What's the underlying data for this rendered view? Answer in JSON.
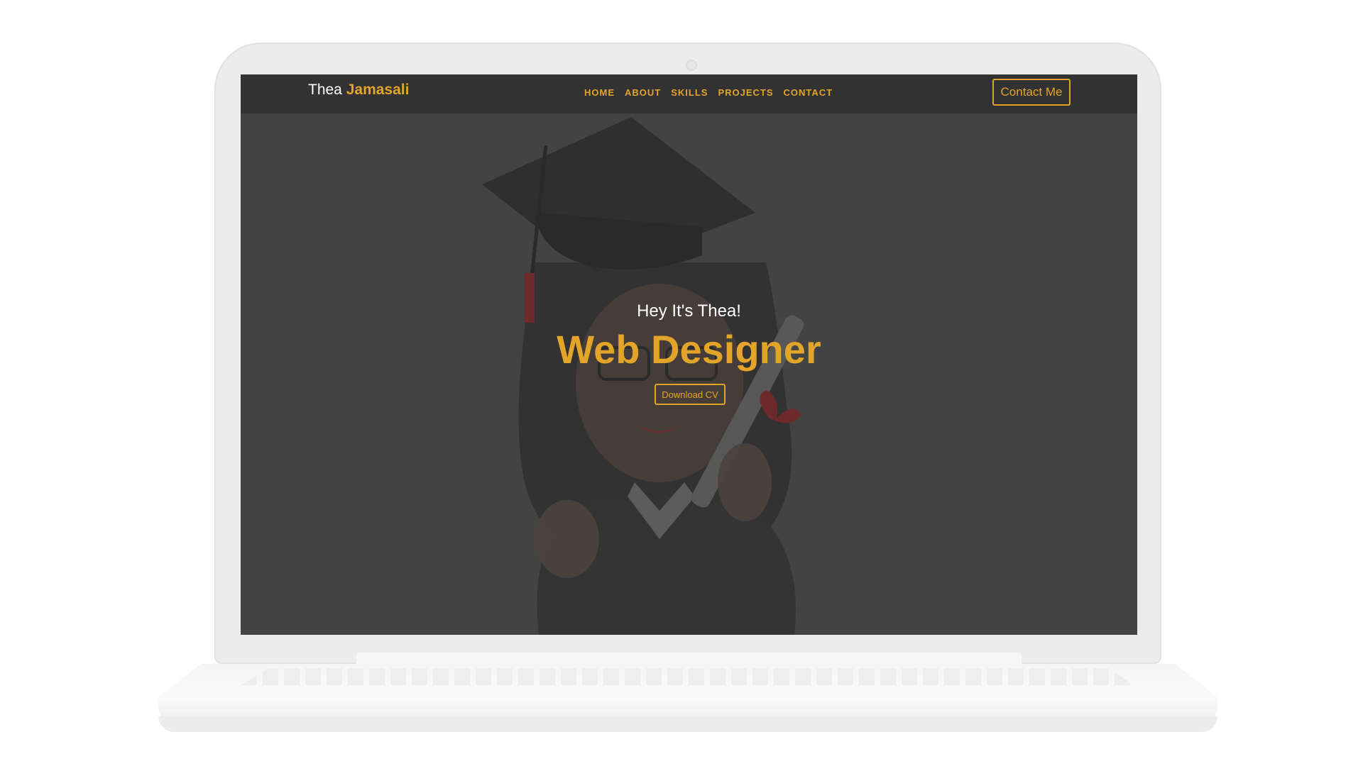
{
  "navbar": {
    "brand_first": "Thea",
    "brand_last": "Jamasali",
    "links": [
      "HOME",
      "ABOUT",
      "SKILLS",
      "PROJECTS",
      "CONTACT"
    ],
    "contact_button": "Contact Me"
  },
  "hero": {
    "greeting": "Hey It's Thea!",
    "title": "Web Designer",
    "cta": "Download CV",
    "illustration": "graduate-avatar-illustration"
  },
  "colors": {
    "accent": "#e2a52a",
    "navbar_bg": "#323232",
    "hero_bg": "#434343",
    "device_frame": "#ececec"
  }
}
